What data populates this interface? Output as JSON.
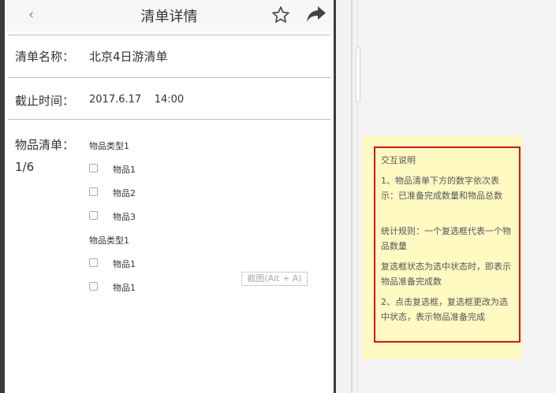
{
  "nav": {
    "back_glyph": "‹",
    "title": "清单详情",
    "icons": [
      "chevron-left-icon",
      "star-icon",
      "share-icon"
    ]
  },
  "fields": {
    "name_label": "清单名称：",
    "name_value": "北京4日游清单",
    "deadline_label": "截止时间：",
    "deadline_value": "2017.6.17    14:00",
    "items_label": "物品清单：",
    "items_count": "1/6"
  },
  "groups": [
    {
      "type": "物品类型1",
      "items": [
        "物品1",
        "物品2",
        "物品3"
      ]
    },
    {
      "type": "物品类型1",
      "items": [
        "物品1",
        "物品1"
      ]
    }
  ],
  "screenshot_hint": "截图(Alt + A)",
  "note": {
    "title": "交互说明",
    "p1": "1、物品清单下方的数字依次表示：已准备完成数量和物品总数",
    "p2": "统计规则：一个复选框代表一个物品数量",
    "p3": "复选框状态为选中状态时，即表示物品准备完成数",
    "p4": "2、点击复选框，复选框更改为选中状态，表示物品准备完成"
  },
  "colors": {
    "note_background": "#fff9c2",
    "note_border": "#d21414",
    "frame": "#3a3a3a"
  }
}
